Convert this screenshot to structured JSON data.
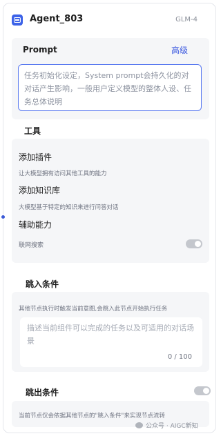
{
  "header": {
    "agent_name": "Agent_803",
    "model": "GLM-4"
  },
  "prompt": {
    "title": "Prompt",
    "advanced_label": "高级",
    "placeholder": "任务初始化设定，System prompt会持久化的对对话产生影响，一般用户定义模型的整体人设、任务总体说明"
  },
  "tools": {
    "title": "工具",
    "items": [
      {
        "label": "添加插件",
        "desc": "让大模型拥有访问其他工具的能力"
      },
      {
        "label": "添加知识库",
        "desc": "大模型基于特定的知识来进行问答对话"
      },
      {
        "label": "辅助能力"
      }
    ],
    "web_search_label": "联网搜索"
  },
  "jump_in": {
    "title": "跳入条件",
    "desc": "其他节点执行时触发当前意图,会跳入此节点开始执行任务",
    "placeholder": "描述当前组件可以完成的任务以及可适用的对话场景",
    "counter": "0 / 100"
  },
  "jump_out": {
    "title": "跳出条件",
    "desc": "当前节点仅会依据其他节点的\"跳入条件\"来实现节点流转"
  },
  "watermark": "公众号 · AIGC新知"
}
